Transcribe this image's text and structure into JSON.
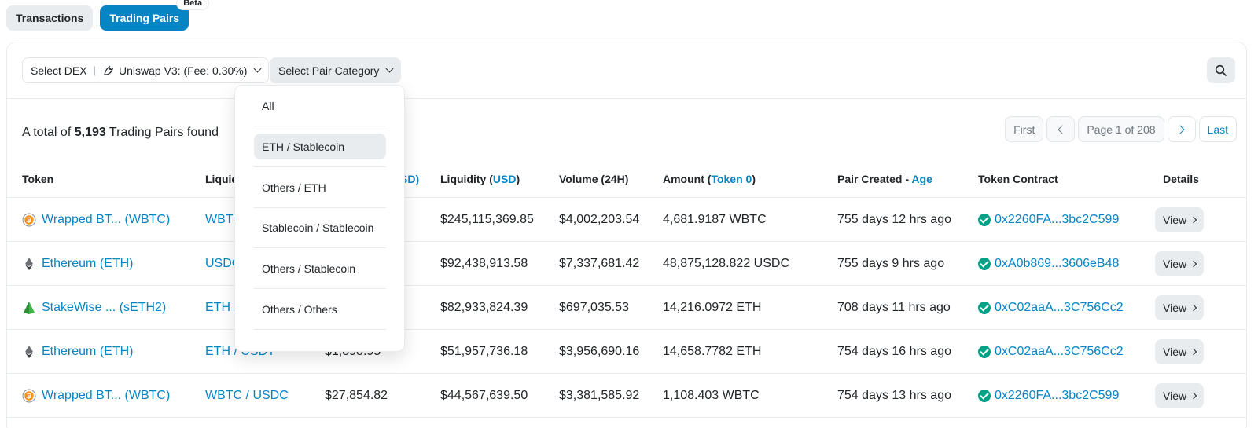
{
  "tabs": [
    {
      "label": "Transactions"
    },
    {
      "label": "Trading Pairs",
      "badge": "Beta"
    }
  ],
  "filters": {
    "dex_label": "Select DEX",
    "dex_value": "Uniswap V3: (Fee: 0.30%)",
    "category_label": "Select Pair Category"
  },
  "summary": {
    "prefix": "A total of",
    "count": "5,193",
    "suffix": "Trading Pairs found"
  },
  "pagination": {
    "first": "First",
    "page_info": "Page 1 of 208",
    "last": "Last"
  },
  "table": {
    "headers": {
      "token": "Token",
      "liquidity_pair": "Liquid",
      "price_tail": "SD)",
      "liquidity_usd_pre": "Liquidity (",
      "liquidity_usd_unit": "USD",
      "liquidity_usd_post": ")",
      "volume": "Volume (24H)",
      "amount_pre": "Amount (",
      "amount_unit": "Token 0",
      "amount_post": ")",
      "created_pre": "Pair Created - ",
      "created_age": "Age",
      "contract": "Token Contract",
      "details": "Details"
    },
    "rows": [
      {
        "token": "Wrapped BT... (WBTC)",
        "icon": "bitcoin-icon",
        "pair": "WBTC",
        "price": "",
        "liquidity": "$245,115,369.85",
        "volume": "$4,002,203.54",
        "amount": "4,681.9187 WBTC",
        "created": "755 days 12 hrs ago",
        "contract": "0x2260FA...3bc2C599",
        "view": "View"
      },
      {
        "token": "Ethereum (ETH)",
        "icon": "ethereum-icon",
        "pair": "USDC",
        "price": "",
        "liquidity": "$92,438,913.58",
        "volume": "$7,337,681.42",
        "amount": "48,875,128.822 USDC",
        "created": "755 days 9 hrs ago",
        "contract": "0xA0b869...3606eB48",
        "view": "View"
      },
      {
        "token": "StakeWise ... (sETH2)",
        "icon": "stakewise-icon",
        "pair": "ETH /",
        "price": "",
        "liquidity": "$82,933,824.39",
        "volume": "$697,035.53",
        "amount": "14,216.0972 ETH",
        "created": "708 days 11 hrs ago",
        "contract": "0xC02aaA...3C756Cc2",
        "view": "View"
      },
      {
        "token": "Ethereum (ETH)",
        "icon": "ethereum-icon",
        "pair": "ETH / USDT",
        "price": "$1,898.95",
        "liquidity": "$51,957,736.18",
        "volume": "$3,956,690.16",
        "amount": "14,658.7782 ETH",
        "created": "754 days 16 hrs ago",
        "contract": "0xC02aaA...3C756Cc2",
        "view": "View"
      },
      {
        "token": "Wrapped BT... (WBTC)",
        "icon": "bitcoin-icon",
        "pair": "WBTC / USDC",
        "price": "$27,854.82",
        "liquidity": "$44,567,639.50",
        "volume": "$3,381,585.92",
        "amount": "1,108.403 WBTC",
        "created": "754 days 13 hrs ago",
        "contract": "0x2260FA...3bc2C599",
        "view": "View"
      }
    ]
  },
  "category_menu": {
    "items": [
      "All",
      "ETH / Stablecoin",
      "Others / ETH",
      "Stablecoin / Stablecoin",
      "Others / Stablecoin",
      "Others / Others"
    ],
    "selected": "ETH / Stablecoin"
  },
  "colors": {
    "accent": "#0784c3",
    "verified": "#00a186",
    "button_bg": "#e9ecef"
  }
}
